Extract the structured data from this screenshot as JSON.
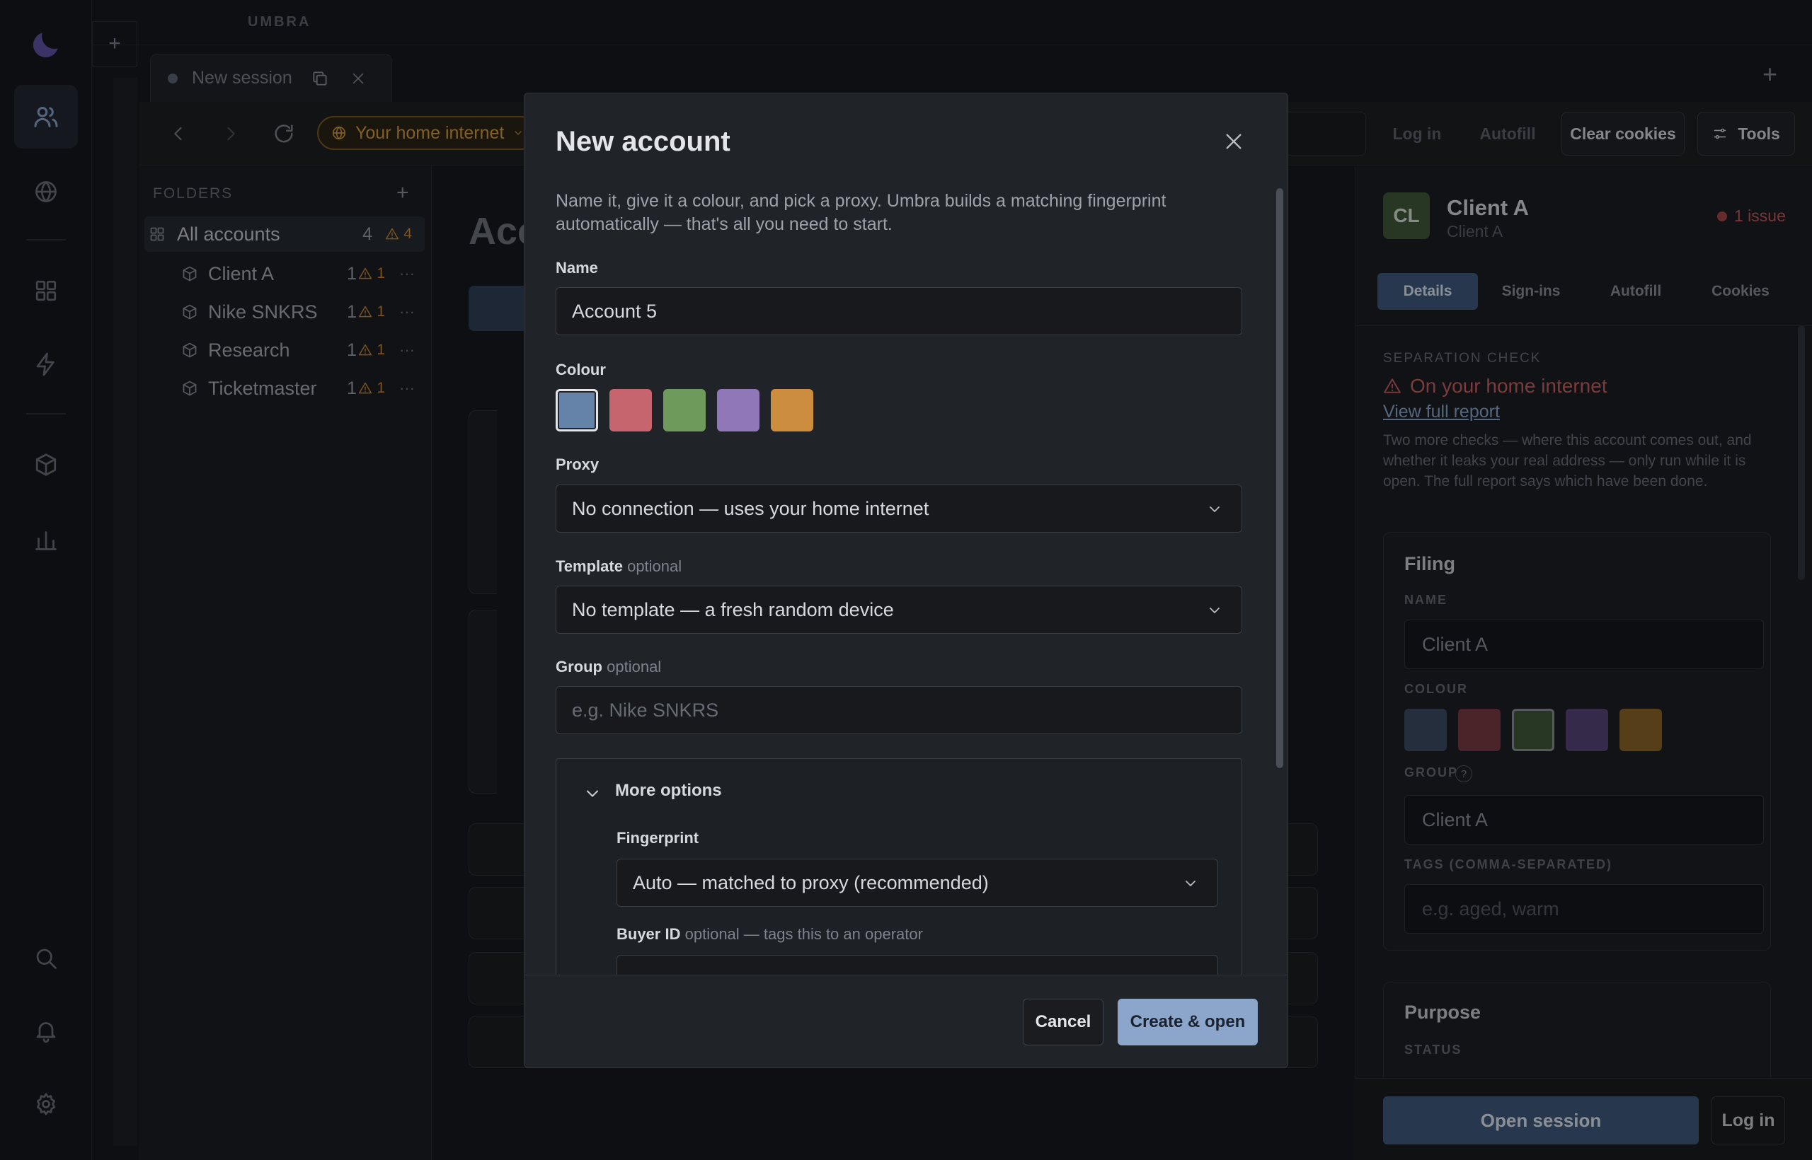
{
  "app": {
    "brand": "UMBRA"
  },
  "tab": {
    "label": "New session"
  },
  "toolbar": {
    "network_label": "Your home internet",
    "login_label": "Log in",
    "autofill_label": "Autofill",
    "clear_cookies_label": "Clear cookies",
    "tools_label": "Tools"
  },
  "folders": {
    "header": "FOLDERS",
    "items": [
      {
        "label": "All accounts",
        "count": "4",
        "warn": "4"
      },
      {
        "label": "Client A",
        "count": "1",
        "warn": "1"
      },
      {
        "label": "Nike SNKRS",
        "count": "1",
        "warn": "1"
      },
      {
        "label": "Research",
        "count": "1",
        "warn": "1"
      },
      {
        "label": "Ticketmaster",
        "count": "1",
        "warn": "1"
      }
    ]
  },
  "center": {
    "title": "Acc"
  },
  "detail": {
    "avatar": "CL",
    "name": "Client A",
    "subtitle": "Client A",
    "issue": "1 issue",
    "tabs": [
      "Details",
      "Sign-ins",
      "Autofill",
      "Cookies"
    ],
    "separation_head": "SEPARATION CHECK",
    "separation_warn": "On your home internet",
    "separation_link": "View full report",
    "separation_body": "Two more checks — where this account comes out, and whether it leaks your real address — only run while it is open. The full report says which have been done.",
    "filing": {
      "title": "Filing",
      "name_label": "NAME",
      "name_value": "Client A",
      "colour_label": "COLOUR",
      "group_label": "GROUP",
      "group_value": "Client A",
      "tags_label": "TAGS (COMMA-SEPARATED)",
      "tags_placeholder": "e.g. aged, warm",
      "swatches": [
        "#3b4b62",
        "#7a3b44",
        "#3f5a3a",
        "#564577",
        "#8a6428"
      ]
    },
    "purpose": {
      "title": "Purpose",
      "status_label": "STATUS"
    },
    "open_session_label": "Open session",
    "login_label": "Log in"
  },
  "modal": {
    "title": "New account",
    "description": "Name it, give it a colour, and pick a proxy. Umbra builds a matching fingerprint automatically — that's all you need to start.",
    "name_label": "Name",
    "name_value": "Account 5",
    "colour_label": "Colour",
    "colours": [
      "#6582a8",
      "#c6656e",
      "#6e9a5c",
      "#8f77b8",
      "#cc8e3e"
    ],
    "proxy_label": "Proxy",
    "proxy_value": "No connection — uses your home internet",
    "template_label": "Template",
    "template_optional": "optional",
    "template_value": "No template — a fresh random device",
    "group_label": "Group",
    "group_optional": "optional",
    "group_placeholder": "e.g. Nike SNKRS",
    "more_options_label": "More options",
    "fingerprint_label": "Fingerprint",
    "fingerprint_value": "Auto — matched to proxy (recommended)",
    "buyer_label": "Buyer ID",
    "buyer_optional": "optional — tags this to an operator",
    "cancel_label": "Cancel",
    "create_label": "Create & open"
  }
}
